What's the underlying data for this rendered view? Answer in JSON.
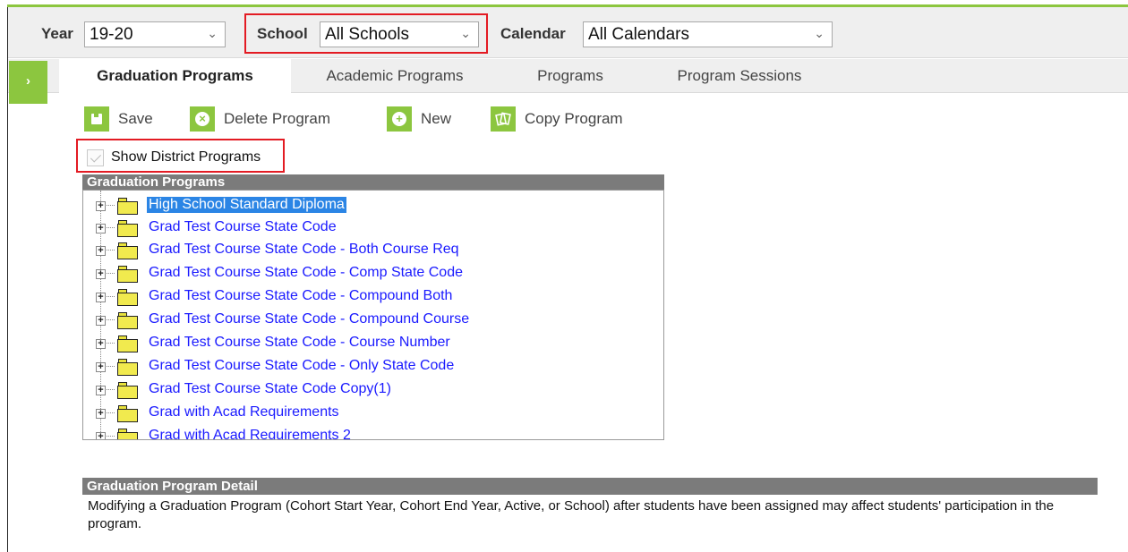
{
  "context": {
    "year_label": "Year",
    "year_value": "19-20",
    "school_label": "School",
    "school_value": "All Schools",
    "calendar_label": "Calendar",
    "calendar_value": "All Calendars"
  },
  "sidebar_toggle": "›",
  "tabs": [
    {
      "label": "Graduation Programs",
      "active": true
    },
    {
      "label": "Academic Programs",
      "active": false
    },
    {
      "label": "Programs",
      "active": false
    },
    {
      "label": "Program Sessions",
      "active": false
    }
  ],
  "toolbar": {
    "save_label": "Save",
    "delete_label": "Delete Program",
    "new_label": "New",
    "copy_label": "Copy Program"
  },
  "show_district_label": "Show District Programs",
  "tree": {
    "header": "Graduation Programs",
    "items": [
      "High School Standard Diploma",
      "Grad Test Course State Code",
      "Grad Test Course State Code - Both Course Req",
      "Grad Test Course State Code - Comp State Code",
      "Grad Test Course State Code - Compound Both",
      "Grad Test Course State Code - Compound Course",
      "Grad Test Course State Code - Course Number",
      "Grad Test Course State Code - Only State Code",
      "Grad Test Course State Code Copy(1)",
      "Grad with Acad Requirements",
      "Grad with Acad Requirements 2"
    ]
  },
  "detail": {
    "header": "Graduation Program Detail",
    "message": "Modifying a Graduation Program (Cohort Start Year, Cohort End Year, Active, or School) after students have been assigned may affect students' participation in the program."
  },
  "colors": {
    "brand_green": "#8cc63f",
    "highlight_red": "#e31b23",
    "link_blue": "#1a1aff",
    "selection_blue": "#2b85e5",
    "header_gray": "#7b7b7b"
  }
}
